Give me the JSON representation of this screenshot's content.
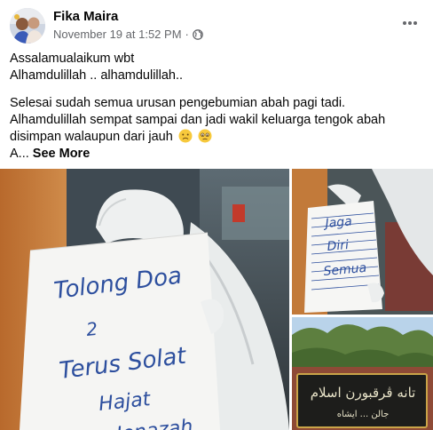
{
  "post": {
    "author": "Fika Maira",
    "timestamp": "November 19 at 1:52 PM",
    "separator": "·",
    "privacy_icon": "globe-icon",
    "more_icon": "ellipsis-icon",
    "greeting_line1": "Assalamualaikum wbt",
    "greeting_line2": "Alhamdulillah .. alhamdulillah..",
    "body_line1": "Selesai sudah semua urusan pengebumian abah pagi tadi.",
    "body_line2": "Alhamdulillah sempat sampai dan jadi wakil keluarga tengok abah",
    "body_line3": "disimpan walaupun dari jauh",
    "emojis": [
      "sad-face-emoji",
      "crying-face-emoji"
    ],
    "truncated_start": "A...",
    "see_more": "See More"
  },
  "photos": {
    "main_note": {
      "line1": "Tolong Doa",
      "line2": "2",
      "line3": "Terus Solat",
      "line4": "Hajat",
      "line5": "Jenazah"
    },
    "right_note": {
      "line1": "Jaga",
      "line2": "Diri",
      "line3": "Semua"
    },
    "sign": {
      "line1": "تانه ڤرقبورن اسلام",
      "line2": "جالن ...  ايشاه"
    }
  },
  "colors": {
    "secondary_text": "#65676b",
    "primary_text": "#050505",
    "ink_blue": "#2d4f9e"
  }
}
